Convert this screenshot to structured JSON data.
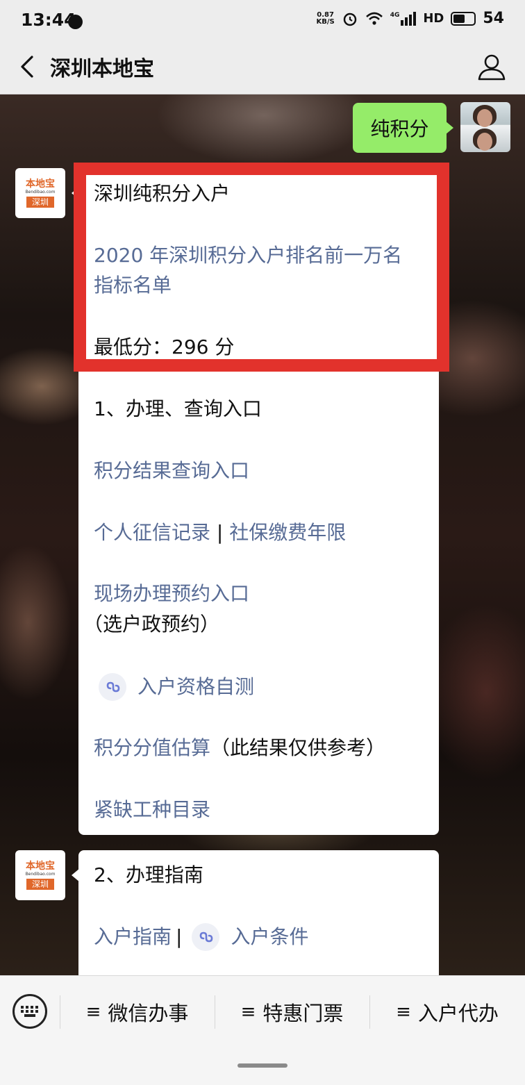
{
  "status_bar": {
    "time": "13:44",
    "net_speed_top": "0.87",
    "net_speed_bottom": "KB/S",
    "network": "4G",
    "hd": "HD",
    "battery": "54"
  },
  "nav": {
    "title": "深圳本地宝"
  },
  "avatar_brand": {
    "name": "本地宝",
    "site": "Bendibao.com",
    "city": "深圳"
  },
  "messages": {
    "sent": "纯积分",
    "card1": {
      "title": "深圳纯积分入户",
      "link_line1": "2020 年深圳积分入户排名前一万名",
      "link_line2": "指标名单",
      "min_score": "最低分：296 分",
      "section_title": "1、办理、查询入口",
      "link_result": "积分结果查询入口",
      "link_credit": "个人征信记录",
      "separator": "|",
      "link_social": "社保缴费年限",
      "link_appointment": "现场办理预约入口",
      "appointment_note": "（选户政预约）",
      "link_selftest": "入户资格自测",
      "link_estimate": "积分分值估算",
      "estimate_note": "（此结果仅供参考）",
      "link_shortage": "紧缺工种目录"
    },
    "card2": {
      "section_title": "2、办理指南",
      "link_guide": "入户指南",
      "separator": "|",
      "link_conditions": "入户条件"
    }
  },
  "menu": {
    "items": [
      "微信办事",
      "特惠门票",
      "入户代办"
    ],
    "icon": "≡"
  },
  "colors": {
    "link": "#576b95",
    "sent_bubble": "#95ec69",
    "highlight": "#e2322c",
    "brand": "#e0672a"
  }
}
